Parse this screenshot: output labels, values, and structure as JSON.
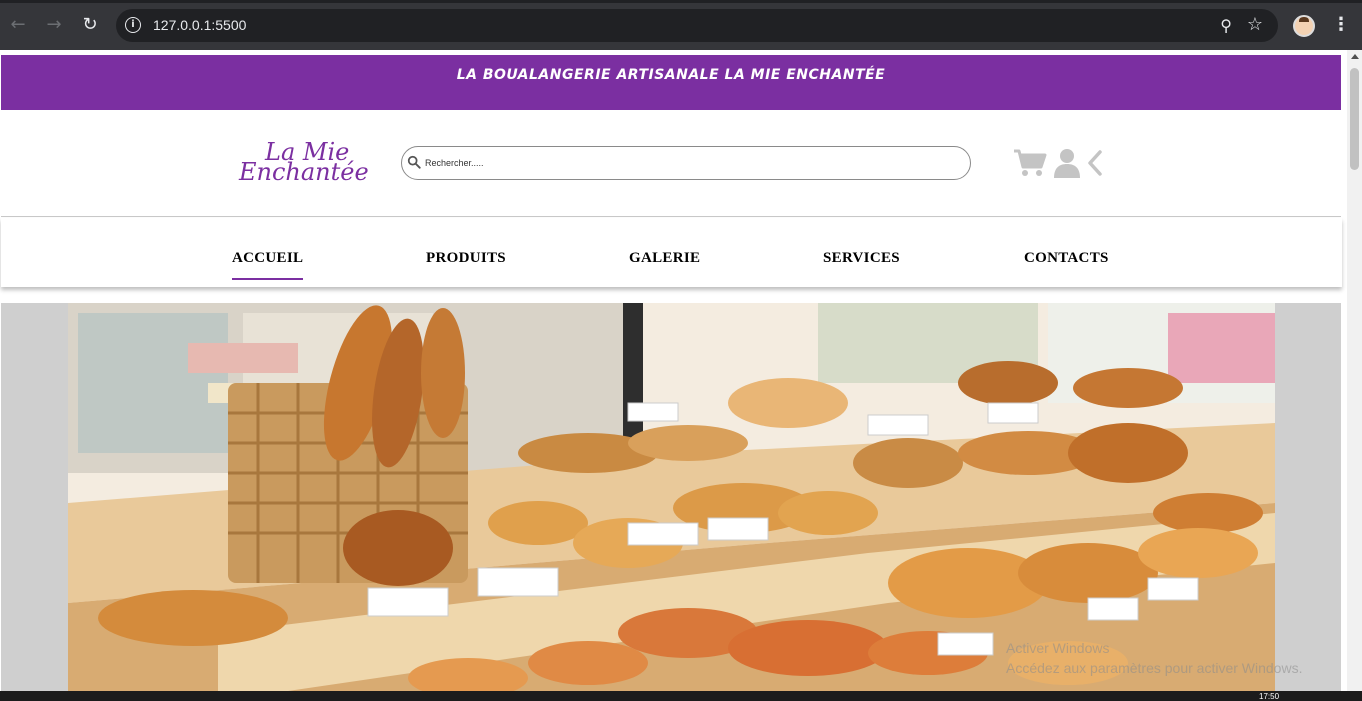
{
  "browser": {
    "url": "127.0.0.1:5500",
    "back_icon": "arrow-left-icon",
    "forward_icon": "arrow-right-icon",
    "reload_icon": "reload-icon"
  },
  "banner": {
    "text": "LA BOUALANGERIE ARTISANALE LA MIE ENCHANTÉE",
    "color": "#7b2fa1"
  },
  "header": {
    "logo_line1": "La Mie",
    "logo_line2": "Enchantée",
    "search_placeholder": "Rechercher.....",
    "icons": [
      "cart-icon",
      "user-icon",
      "chevron-left-icon"
    ]
  },
  "nav": {
    "items": [
      {
        "label": "ACCUEIL",
        "active": true
      },
      {
        "label": "PRODUITS",
        "active": false
      },
      {
        "label": "GALERIE",
        "active": false
      },
      {
        "label": "SERVICES",
        "active": false
      },
      {
        "label": "CONTACTS",
        "active": false
      }
    ]
  },
  "watermark": {
    "line1": "Activer Windows",
    "line2": "Accédez aux paramètres pour activer Windows."
  },
  "taskbar": {
    "time": "17:50"
  }
}
